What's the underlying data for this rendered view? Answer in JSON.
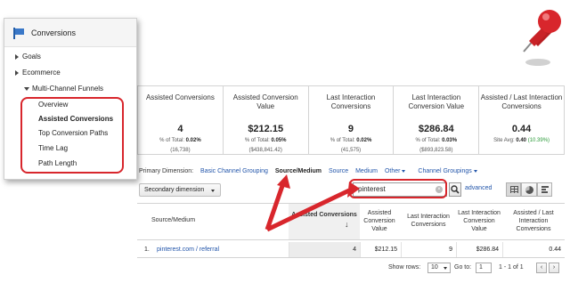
{
  "sidebar": {
    "header": "Conversions",
    "items": [
      "Goals",
      "Ecommerce"
    ],
    "group": "Multi-Channel Funnels",
    "subitems": [
      "Overview",
      "Assisted Conversions",
      "Top Conversion Paths",
      "Time Lag",
      "Path Length"
    ],
    "active": "Assisted Conversions"
  },
  "metrics": [
    {
      "title": "Assisted Conversions",
      "value": "4",
      "sub1_prefix": "% of Total: ",
      "sub1_val": "0.02%",
      "sub2": "(16,738)"
    },
    {
      "title": "Assisted Conversion Value",
      "value": "$212.15",
      "sub1_prefix": "% of Total: ",
      "sub1_val": "0.05%",
      "sub2": "($438,841.42)"
    },
    {
      "title": "Last Interaction Conversions",
      "value": "9",
      "sub1_prefix": "% of Total: ",
      "sub1_val": "0.02%",
      "sub2": "(41,575)"
    },
    {
      "title": "Last Interaction Conversion Value",
      "value": "$286.84",
      "sub1_prefix": "% of Total: ",
      "sub1_val": "0.03%",
      "sub2": "($893,823.58)"
    },
    {
      "title": "Assisted / Last Interaction Conversions",
      "value": "0.44",
      "sub1_prefix": "Site Avg: ",
      "sub1_val": "0.40",
      "sub2": "(10.39%)"
    }
  ],
  "primary_dimension": {
    "label": "Primary Dimension:",
    "options": [
      "Basic Channel Grouping",
      "Source/Medium",
      "Source",
      "Medium",
      "Other",
      "Channel Groupings"
    ],
    "active": "Source/Medium"
  },
  "toolbar": {
    "secondary_dimension": "Secondary dimension",
    "search_value": "pinterest",
    "advanced": "advanced"
  },
  "table": {
    "headers": [
      "Source/Medium",
      "Assisted Conversions",
      "Assisted Conversion Value",
      "Last Interaction Conversions",
      "Last Interaction Conversion Value",
      "Assisted / Last Interaction Conversions"
    ],
    "rows": [
      {
        "index": "1.",
        "source": "pinterest.com / referral",
        "assisted": "4",
        "assisted_value": "$212.15",
        "last": "9",
        "last_value": "$286.84",
        "ratio": "0.44"
      }
    ]
  },
  "footer": {
    "show_rows_label": "Show rows:",
    "show_rows_value": "10",
    "goto_label": "Go to:",
    "goto_value": "1",
    "range": "1 - 1 of 1"
  },
  "colors": {
    "accent_red": "#d8262c",
    "link_blue": "#2255aa",
    "flag_blue": "#3a78c8"
  }
}
